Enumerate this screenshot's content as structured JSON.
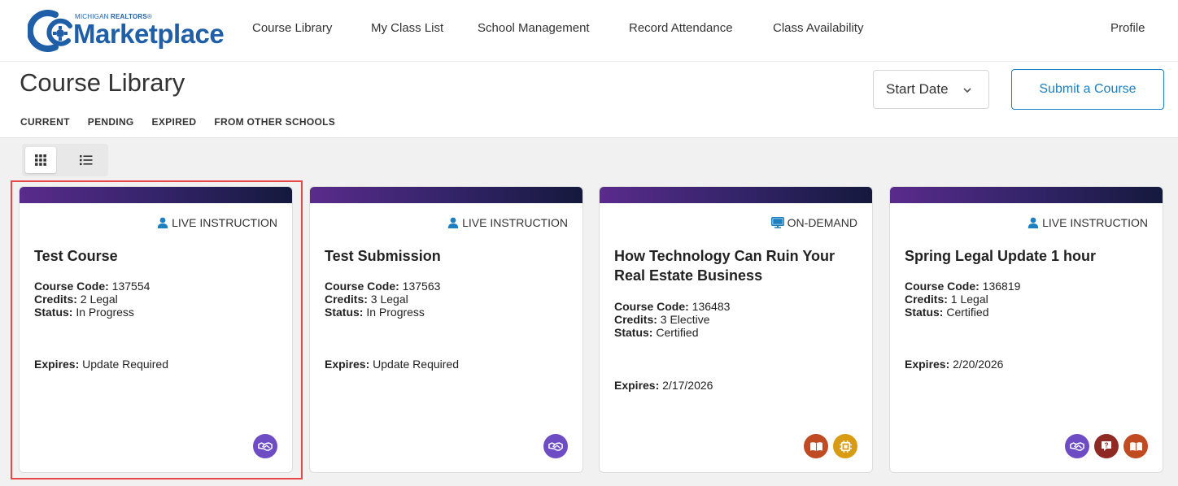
{
  "header": {
    "logo_sub_prefix": "MICHIGAN ",
    "logo_sub_bold": "REALTORS",
    "logo_sub_mark": "®",
    "logo_main": "Marketplace",
    "nav": [
      "Course Library",
      "My Class List",
      "School Management",
      "Record Attendance",
      "Class Availability"
    ],
    "profile": "Profile"
  },
  "page": {
    "title": "Course Library",
    "tabs": [
      "CURRENT",
      "PENDING",
      "EXPIRED",
      "FROM OTHER SCHOOLS"
    ],
    "sort_label": "Start Date",
    "submit_label": "Submit a Course"
  },
  "labels": {
    "course_code": "Course Code:",
    "credits": "Credits:",
    "status": "Status:",
    "expires": "Expires:"
  },
  "courses": [
    {
      "type": "LIVE INSTRUCTION",
      "type_icon": "person-icon",
      "title": "Test Course",
      "code": " 137554",
      "credits": " 2 Legal",
      "status": " In Progress",
      "expires": " Update Required",
      "icons": [
        "handshake-icon"
      ]
    },
    {
      "type": "LIVE INSTRUCTION",
      "type_icon": "person-icon",
      "title": "Test Submission",
      "code": " 137563",
      "credits": " 3 Legal",
      "status": " In Progress",
      "expires": " Update Required",
      "icons": [
        "handshake-icon"
      ]
    },
    {
      "type": "ON-DEMAND",
      "type_icon": "monitor-icon",
      "title": "How Technology Can Ruin Your Real Estate Business",
      "code": " 136483",
      "credits": " 3 Elective",
      "status": " Certified",
      "expires": " 2/17/2026",
      "icons": [
        "book-icon",
        "chip-icon"
      ]
    },
    {
      "type": "LIVE INSTRUCTION",
      "type_icon": "person-icon",
      "title": "Spring Legal Update 1 hour",
      "code": " 136819",
      "credits": " 1 Legal",
      "status": " Certified",
      "expires": " 2/20/2026",
      "icons": [
        "handshake-icon",
        "question-icon",
        "book-icon"
      ]
    }
  ],
  "colors": {
    "brand_blue": "#1f5fa8",
    "accent_blue": "#1d7fc0",
    "card_bar_start": "#5a2b8c",
    "card_bar_end": "#15193d",
    "selection_outline": "#e8474a"
  }
}
